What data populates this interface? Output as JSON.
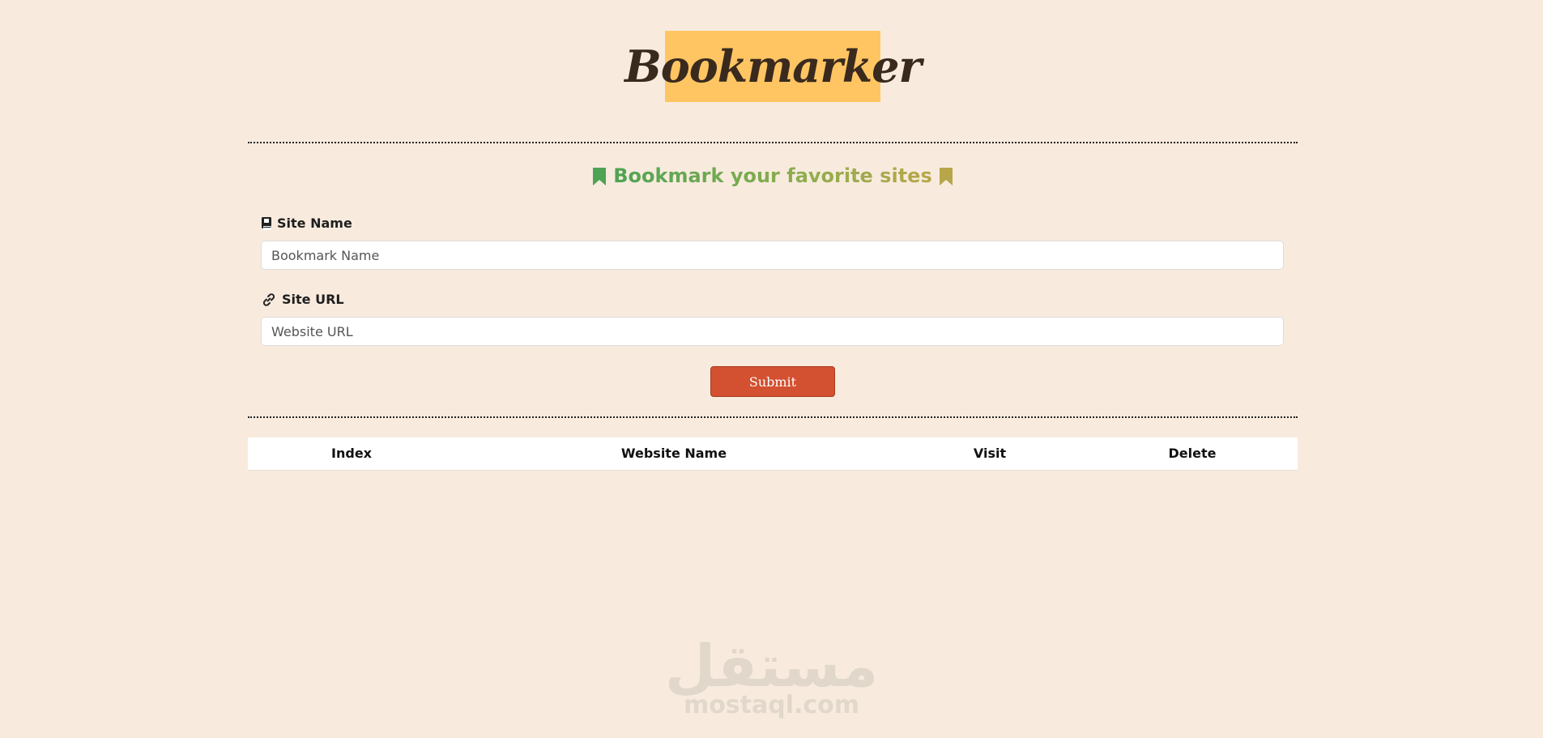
{
  "logo": {
    "text": "Bookmarker",
    "background": "#ffc562"
  },
  "heading": {
    "text": "Bookmark your favorite sites",
    "left_icon": "bookmark-icon",
    "right_icon": "bookmark-icon",
    "colors": [
      "#4ea355",
      "#b8a64a"
    ]
  },
  "form": {
    "site_name": {
      "label": "Site Name",
      "icon": "book-icon",
      "placeholder": "Bookmark Name",
      "value": ""
    },
    "site_url": {
      "label": "Site URL",
      "icon": "link-icon",
      "placeholder": "Website URL",
      "value": ""
    },
    "submit_label": "Submit",
    "submit_color": "#d35030"
  },
  "table": {
    "headers": [
      "Index",
      "Website Name",
      "Visit",
      "Delete"
    ],
    "rows": []
  },
  "watermark": {
    "arabic": "مستقل",
    "latin": "mostaql.com"
  },
  "colors": {
    "page_background": "#f8ebde",
    "accent": "#d35030"
  }
}
